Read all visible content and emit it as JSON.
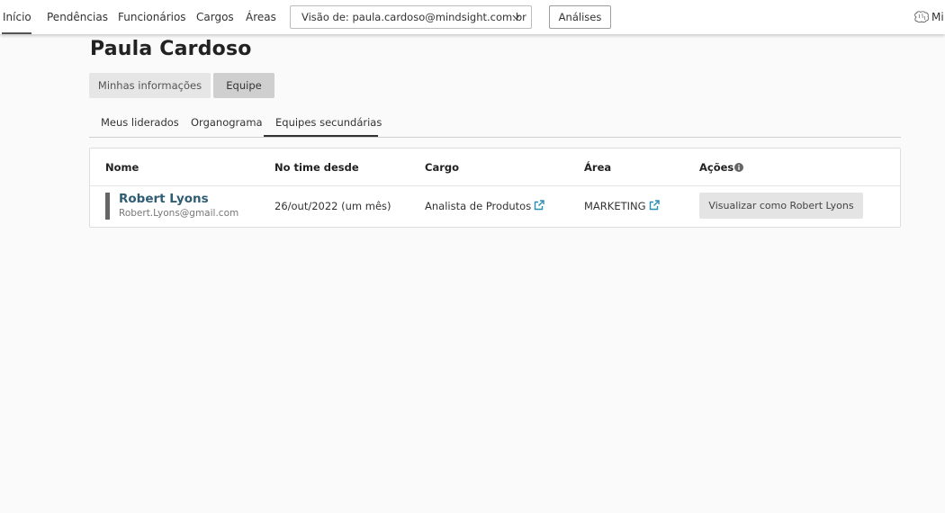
{
  "nav": {
    "items": [
      {
        "label": "Início",
        "active": true
      },
      {
        "label": "Pendências"
      },
      {
        "label": "Funcionários"
      },
      {
        "label": "Cargos"
      },
      {
        "label": "Áreas"
      }
    ],
    "vision_select": "Visão de: paula.cardoso@mindsight.com.br",
    "analises": "Análises",
    "logo_text": "Mi"
  },
  "page": {
    "title": "Paula Cardoso",
    "segments": [
      "Minhas informações",
      "Equipe"
    ],
    "active_segment": "Equipe",
    "subtabs": [
      "Meus liderados",
      "Organograma",
      "Equipes secundárias"
    ],
    "active_subtab": "Equipes secundárias"
  },
  "table": {
    "headers": [
      "Nome",
      "No time desde",
      "Cargo",
      "Área",
      "Ações"
    ],
    "rows": [
      {
        "name": "Robert Lyons",
        "email": "Robert.Lyons@gmail.com",
        "since": "26/out/2022 (um mês)",
        "cargo": "Analista de Produtos",
        "area": "MARKETING",
        "action": "Visualizar como Robert Lyons"
      }
    ]
  },
  "colors": {
    "link": "#2f5d73",
    "external_icon": "#2a8fb5",
    "row_bar": "#666666"
  },
  "icons": {
    "external_link": "external-link-icon",
    "info": "info-icon",
    "chevron": "chevron-down-icon",
    "logo": "brain-logo-icon"
  }
}
